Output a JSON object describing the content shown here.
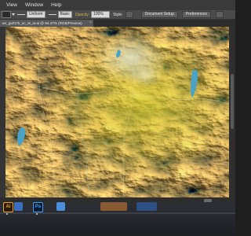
{
  "menu": {
    "items": [
      "View",
      "Window",
      "Help"
    ]
  },
  "control_bar": {
    "stroke_profile": "Uniform",
    "brush": "Basic",
    "opacity_label": "Opacity:",
    "opacity_value": "100%",
    "style_label": "Style:",
    "document_setup_label": "Document Setup",
    "preferences_label": "Preferences"
  },
  "document_tab": {
    "title": "ee_gwf17k_ac_i9_at.ai @ 94.47% (RGB/Preview)",
    "close_symbol": "×"
  },
  "dock": {
    "apps": [
      {
        "name": "illustrator-icon",
        "label": "Ai"
      },
      {
        "name": "photoshop-icon",
        "label": "Ps"
      }
    ]
  },
  "colors": {
    "opacity_accent": "#e0b14a",
    "terrain_high": "#6b2a0c",
    "terrain_mid": "#c0641a",
    "terrain_low": "#c9b526",
    "urban": "#d8d8b8",
    "water": "#4aa3c6"
  }
}
